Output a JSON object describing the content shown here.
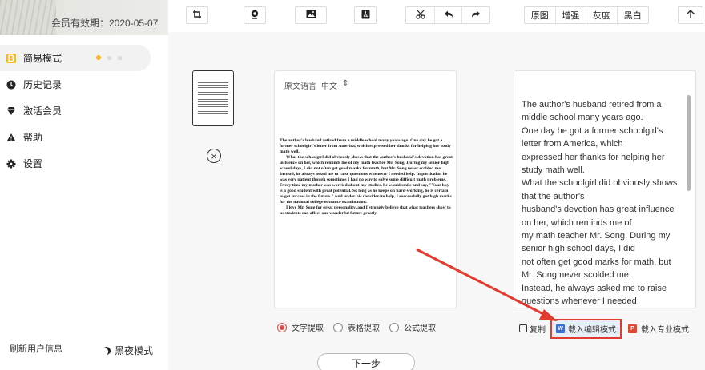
{
  "sidebar": {
    "member_expiry": "会员有效期：2020-05-07",
    "items": [
      {
        "label": "简易模式",
        "icon": "mode-icon"
      },
      {
        "label": "历史记录",
        "icon": "clock-icon"
      },
      {
        "label": "激活会员",
        "icon": "diamond-icon"
      },
      {
        "label": "帮助",
        "icon": "warning-icon"
      },
      {
        "label": "设置",
        "icon": "gear-icon"
      }
    ],
    "refresh_label": "刷新用户信息",
    "night_mode_label": "黑夜模式"
  },
  "toolbar": {
    "filters": [
      "原图",
      "增强",
      "灰度",
      "黑白"
    ]
  },
  "source": {
    "lang_label": "原文语言",
    "lang_value": "中文",
    "lang_arrow": "⇕",
    "paragraphs": [
      "The author's husband retired from a middle school many years ago. One day he got a former schoolgirl's letter from America, which expressed her thanks for helping her study math well.",
      "What the schoolgirl did obviously shows that the author's husband's devotion has great influence on her, which reminds me of my math teacher Mr. Song. During my senior high school days, I did not often get good marks for math, but Mr. Song never scolded me. Instead, he always asked me to raise questions whenever I needed help. In particular, he was very patient though sometimes I had no way to solve some difficult math problems. Every time my mother was worried about my studies, he would smile and say, \"Your boy is a good student with great potential. So long as he keeps on hard-working, he is certain to get success in the future.\" And under his considerate help, I successfully got high marks for the national college entrance examination.",
      "I love Mr. Song for great personality, and I strongly believe that what teachers show to us students can affect our wonderful future greatly."
    ]
  },
  "output": {
    "lines": [
      "The author's husband retired from a",
      "middle school many years ago.",
      "One day he got a former schoolgirl's",
      "letter from America, which",
      "expressed her thanks for helping her",
      "study math well.",
      "What the schoolgirl did obviously shows",
      "that the author's",
      "husband's devotion has great influence",
      "on her, which reminds me of",
      "my math teacher Mr. Song. During my",
      "senior high school days, I did",
      "not often get good marks for math, but",
      "Mr. Song never scolded me.",
      "Instead, he always asked me to raise",
      "questions whenever I needed"
    ]
  },
  "extract": {
    "options": [
      "文字提取",
      "表格提取",
      "公式提取"
    ],
    "selected": "文字提取"
  },
  "actions": {
    "copy": "复制",
    "load_edit": "载入编辑模式",
    "load_pro": "载入专业模式"
  },
  "next_label": "下一步",
  "colors": {
    "accent_red": "#e23a2e",
    "brand_yellow": "#f5b820",
    "word_blue": "#3a6fd8"
  }
}
